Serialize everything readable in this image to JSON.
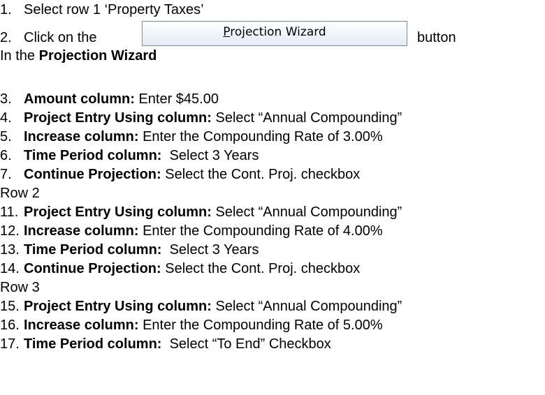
{
  "steps": {
    "s1": {
      "num": "1.",
      "text": "Select row 1 ‘Property Taxes’"
    },
    "s2": {
      "num": "2.",
      "before": "Click on the",
      "after": "button"
    },
    "wizard_intro": {
      "pre": "In the ",
      "bold": "Projection Wizard"
    },
    "s3": {
      "num": "3.",
      "bold": "Amount column:",
      "text": " Enter $45.00"
    },
    "s4": {
      "num": "4.",
      "bold": "Project Entry Using column:",
      "text": " Select “Annual Compounding”"
    },
    "s5": {
      "num": "5.",
      "bold": "Increase column:",
      "text": " Enter the Compounding Rate of 3.00%"
    },
    "s6": {
      "num": "6.",
      "bold": "Time Period column:",
      "text": "  Select 3 Years"
    },
    "s7": {
      "num": "7.",
      "bold": "Continue Projection:",
      "text": " Select the Cont. Proj. checkbox"
    },
    "row2": "Row 2",
    "s11": {
      "num": "11.",
      "bold": "Project Entry Using column:",
      "text": " Select “Annual Compounding”"
    },
    "s12": {
      "num": "12.",
      "bold": "Increase column:",
      "text": " Enter the Compounding Rate of 4.00%"
    },
    "s13": {
      "num": "13.",
      "bold": "Time Period column:",
      "text": "  Select 3 Years"
    },
    "s14": {
      "num": "14.",
      "bold": "Continue Projection:",
      "text": " Select the Cont. Proj. checkbox"
    },
    "row3": "Row 3",
    "s15": {
      "num": "15.",
      "bold": "Project Entry Using column:",
      "text": " Select “Annual Compounding”"
    },
    "s16": {
      "num": "16.",
      "bold": "Increase column:",
      "text": " Enter the Compounding Rate of 5.00%"
    },
    "s17": {
      "num": "17.",
      "bold": "Time Period column:",
      "text": "  Select “To End” Checkbox"
    }
  },
  "button": {
    "mnemonic": "P",
    "rest": "rojection Wizard"
  }
}
